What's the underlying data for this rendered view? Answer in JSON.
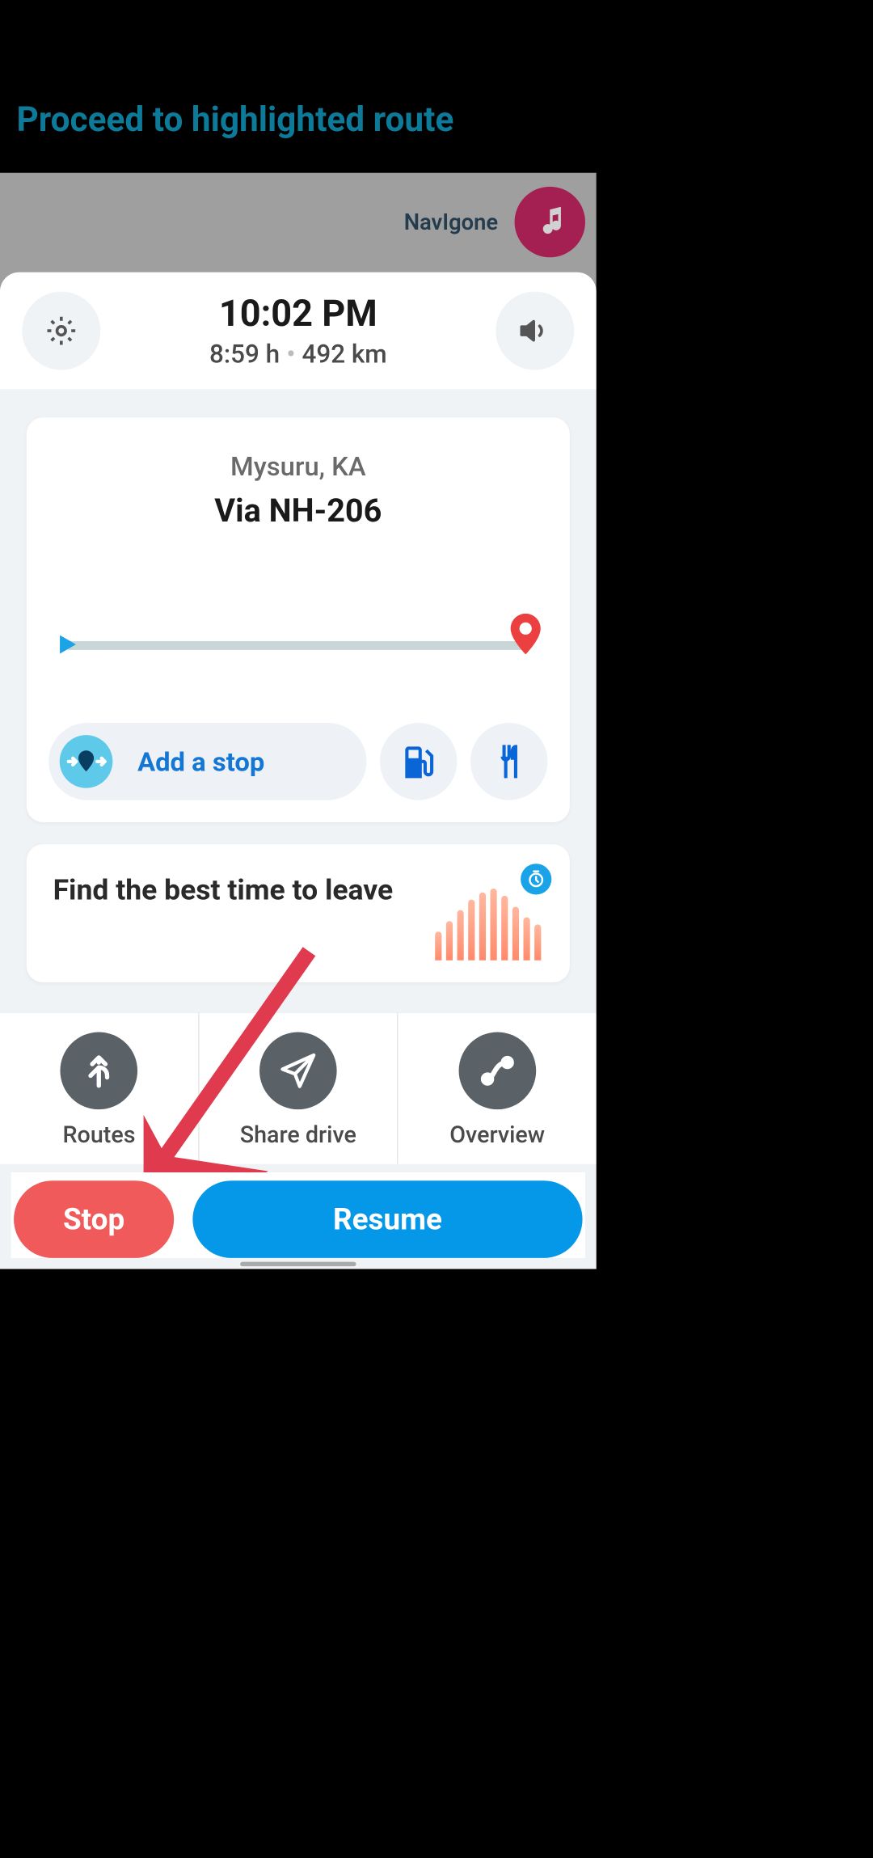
{
  "instruction": "Proceed to highlighted route",
  "app_name": "NavIgone",
  "eta": {
    "arrival_time": "10:02 PM",
    "duration": "8:59 h",
    "distance": "492 km"
  },
  "route": {
    "destination": "Mysuru, KA",
    "via": "Via NH-206",
    "add_stop_label": "Add a stop"
  },
  "leave_card": {
    "title": "Find the best time to leave"
  },
  "actions": {
    "routes": "Routes",
    "share": "Share drive",
    "overview": "Overview"
  },
  "buttons": {
    "stop": "Stop",
    "resume": "Resume"
  }
}
